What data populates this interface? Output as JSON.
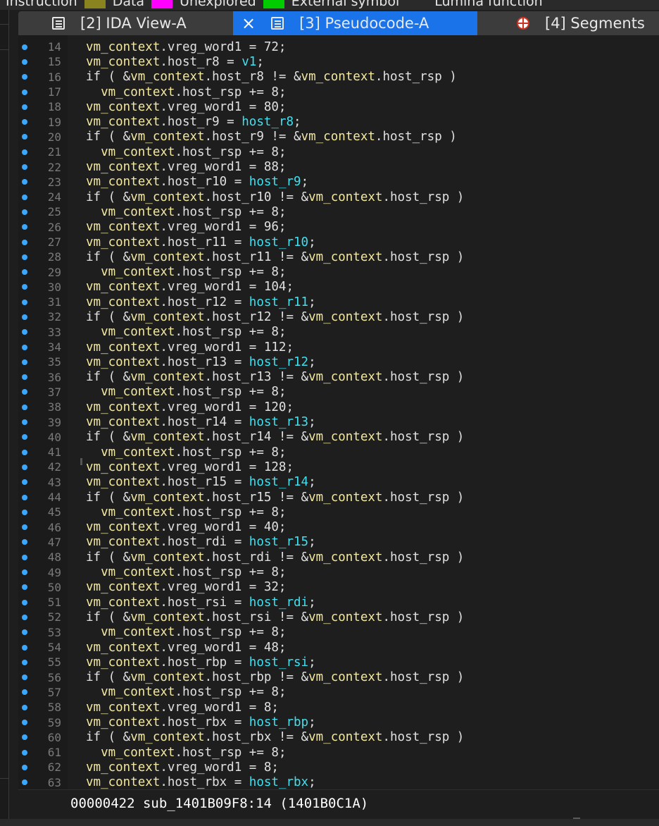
{
  "legend": {
    "items": [
      {
        "label": "Instruction",
        "color": "#f5eec2"
      },
      {
        "label": "Data",
        "color": "#8a8420"
      },
      {
        "label": "Unexplored",
        "color": "#ff00ff"
      },
      {
        "label": "External symbol",
        "color": "#00cc00"
      },
      {
        "label": "Lumina function",
        "color": ""
      }
    ]
  },
  "tabs": [
    {
      "label": "[2] IDA View-A",
      "icon": "document-icon",
      "active": false
    },
    {
      "label": "[3] Pseudocode-A",
      "icon": "document-icon",
      "active": true,
      "close": "×"
    },
    {
      "label": "[4] Segments",
      "icon": "segments-icon",
      "active": false
    }
  ],
  "colors": {
    "active_tab": "#1a73e8",
    "highlight": "#3fe0f0",
    "variable": "#f3e8a0",
    "breakpoint_dot": "#3aa8ff",
    "background": "#1e1e1e"
  },
  "code_lines": [
    {
      "n": "14",
      "ind": "",
      "a": "vm_context",
      "b": ".vreg_word1 = 72;",
      "hl": "",
      "tail": ""
    },
    {
      "n": "15",
      "ind": "",
      "a": "vm_context",
      "b": ".host_r8 = ",
      "hl": "v1",
      "tail": ";"
    },
    {
      "n": "16",
      "ind": "",
      "kind": "if",
      "a": "vm_context",
      "b": ".host_r8 != &",
      "c": "vm_context",
      "d": ".host_rsp )"
    },
    {
      "n": "17",
      "ind": "  ",
      "a": "vm_context",
      "b": ".host_rsp += 8;",
      "hl": "",
      "tail": ""
    },
    {
      "n": "18",
      "ind": "",
      "a": "vm_context",
      "b": ".vreg_word1 = 80;",
      "hl": "",
      "tail": ""
    },
    {
      "n": "19",
      "ind": "",
      "a": "vm_context",
      "b": ".host_r9 = ",
      "hl": "host_r8",
      "tail": ";"
    },
    {
      "n": "20",
      "ind": "",
      "kind": "if",
      "a": "vm_context",
      "b": ".host_r9 != &",
      "c": "vm_context",
      "d": ".host_rsp )"
    },
    {
      "n": "21",
      "ind": "  ",
      "a": "vm_context",
      "b": ".host_rsp += 8;",
      "hl": "",
      "tail": ""
    },
    {
      "n": "22",
      "ind": "",
      "a": "vm_context",
      "b": ".vreg_word1 = 88;",
      "hl": "",
      "tail": ""
    },
    {
      "n": "23",
      "ind": "",
      "a": "vm_context",
      "b": ".host_r10 = ",
      "hl": "host_r9",
      "tail": ";"
    },
    {
      "n": "24",
      "ind": "",
      "kind": "if",
      "a": "vm_context",
      "b": ".host_r10 != &",
      "c": "vm_context",
      "d": ".host_rsp )"
    },
    {
      "n": "25",
      "ind": "  ",
      "a": "vm_context",
      "b": ".host_rsp += 8;",
      "hl": "",
      "tail": ""
    },
    {
      "n": "26",
      "ind": "",
      "a": "vm_context",
      "b": ".vreg_word1 = 96;",
      "hl": "",
      "tail": ""
    },
    {
      "n": "27",
      "ind": "",
      "a": "vm_context",
      "b": ".host_r11 = ",
      "hl": "host_r10",
      "tail": ";"
    },
    {
      "n": "28",
      "ind": "",
      "kind": "if",
      "a": "vm_context",
      "b": ".host_r11 != &",
      "c": "vm_context",
      "d": ".host_rsp )"
    },
    {
      "n": "29",
      "ind": "  ",
      "a": "vm_context",
      "b": ".host_rsp += 8;",
      "hl": "",
      "tail": ""
    },
    {
      "n": "30",
      "ind": "",
      "a": "vm_context",
      "b": ".vreg_word1 = 104;",
      "hl": "",
      "tail": ""
    },
    {
      "n": "31",
      "ind": "",
      "a": "vm_context",
      "b": ".host_r12 = ",
      "hl": "host_r11",
      "tail": ";"
    },
    {
      "n": "32",
      "ind": "",
      "kind": "if",
      "a": "vm_context",
      "b": ".host_r12 != &",
      "c": "vm_context",
      "d": ".host_rsp )"
    },
    {
      "n": "33",
      "ind": "  ",
      "a": "vm_context",
      "b": ".host_rsp += 8;",
      "hl": "",
      "tail": ""
    },
    {
      "n": "34",
      "ind": "",
      "a": "vm_context",
      "b": ".vreg_word1 = 112;",
      "hl": "",
      "tail": ""
    },
    {
      "n": "35",
      "ind": "",
      "a": "vm_context",
      "b": ".host_r13 = ",
      "hl": "host_r12",
      "tail": ";"
    },
    {
      "n": "36",
      "ind": "",
      "kind": "if",
      "a": "vm_context",
      "b": ".host_r13 != &",
      "c": "vm_context",
      "d": ".host_rsp )"
    },
    {
      "n": "37",
      "ind": "  ",
      "a": "vm_context",
      "b": ".host_rsp += 8;",
      "hl": "",
      "tail": ""
    },
    {
      "n": "38",
      "ind": "",
      "a": "vm_context",
      "b": ".vreg_word1 = 120;",
      "hl": "",
      "tail": ""
    },
    {
      "n": "39",
      "ind": "",
      "a": "vm_context",
      "b": ".host_r14 = ",
      "hl": "host_r13",
      "tail": ";"
    },
    {
      "n": "40",
      "ind": "",
      "kind": "if",
      "a": "vm_context",
      "b": ".host_r14 != &",
      "c": "vm_context",
      "d": ".host_rsp )"
    },
    {
      "n": "41",
      "ind": "  ",
      "a": "vm_context",
      "b": ".host_rsp += 8;",
      "hl": "",
      "tail": ""
    },
    {
      "n": "42",
      "ind": "",
      "a": "vm_context",
      "b": ".vreg_word1 = 128;",
      "hl": "",
      "tail": ""
    },
    {
      "n": "43",
      "ind": "",
      "a": "vm_context",
      "b": ".host_r15 = ",
      "hl": "host_r14",
      "tail": ";"
    },
    {
      "n": "44",
      "ind": "",
      "kind": "if",
      "a": "vm_context",
      "b": ".host_r15 != &",
      "c": "vm_context",
      "d": ".host_rsp )"
    },
    {
      "n": "45",
      "ind": "  ",
      "a": "vm_context",
      "b": ".host_rsp += 8;",
      "hl": "",
      "tail": ""
    },
    {
      "n": "46",
      "ind": "",
      "a": "vm_context",
      "b": ".vreg_word1 = 40;",
      "hl": "",
      "tail": ""
    },
    {
      "n": "47",
      "ind": "",
      "a": "vm_context",
      "b": ".host_rdi = ",
      "hl": "host_r15",
      "tail": ";"
    },
    {
      "n": "48",
      "ind": "",
      "kind": "if",
      "a": "vm_context",
      "b": ".host_rdi != &",
      "c": "vm_context",
      "d": ".host_rsp )"
    },
    {
      "n": "49",
      "ind": "  ",
      "a": "vm_context",
      "b": ".host_rsp += 8;",
      "hl": "",
      "tail": ""
    },
    {
      "n": "50",
      "ind": "",
      "a": "vm_context",
      "b": ".vreg_word1 = 32;",
      "hl": "",
      "tail": ""
    },
    {
      "n": "51",
      "ind": "",
      "a": "vm_context",
      "b": ".host_rsi = ",
      "hl": "host_rdi",
      "tail": ";"
    },
    {
      "n": "52",
      "ind": "",
      "kind": "if",
      "a": "vm_context",
      "b": ".host_rsi != &",
      "c": "vm_context",
      "d": ".host_rsp )"
    },
    {
      "n": "53",
      "ind": "  ",
      "a": "vm_context",
      "b": ".host_rsp += 8;",
      "hl": "",
      "tail": ""
    },
    {
      "n": "54",
      "ind": "",
      "a": "vm_context",
      "b": ".vreg_word1 = 48;",
      "hl": "",
      "tail": ""
    },
    {
      "n": "55",
      "ind": "",
      "a": "vm_context",
      "b": ".host_rbp = ",
      "hl": "host_rsi",
      "tail": ";"
    },
    {
      "n": "56",
      "ind": "",
      "kind": "if",
      "a": "vm_context",
      "b": ".host_rbp != &",
      "c": "vm_context",
      "d": ".host_rsp )"
    },
    {
      "n": "57",
      "ind": "  ",
      "a": "vm_context",
      "b": ".host_rsp += 8;",
      "hl": "",
      "tail": ""
    },
    {
      "n": "58",
      "ind": "",
      "a": "vm_context",
      "b": ".vreg_word1 = 8;",
      "hl": "",
      "tail": ""
    },
    {
      "n": "59",
      "ind": "",
      "a": "vm_context",
      "b": ".host_rbx = ",
      "hl": "host_rbp",
      "tail": ";"
    },
    {
      "n": "60",
      "ind": "",
      "kind": "if",
      "a": "vm_context",
      "b": ".host_rbx != &",
      "c": "vm_context",
      "d": ".host_rsp )"
    },
    {
      "n": "61",
      "ind": "  ",
      "a": "vm_context",
      "b": ".host_rsp += 8;",
      "hl": "",
      "tail": ""
    },
    {
      "n": "62",
      "ind": "",
      "a": "vm_context",
      "b": ".vreg_word1 = 8;",
      "hl": "",
      "tail": ""
    },
    {
      "n": "63",
      "ind": "",
      "a": "vm_context",
      "b": ".host_rbx = ",
      "hl": "host_rbx",
      "tail": ";"
    }
  ],
  "status": {
    "text": "00000422 sub_1401B09F8:14 (1401B0C1A)"
  }
}
